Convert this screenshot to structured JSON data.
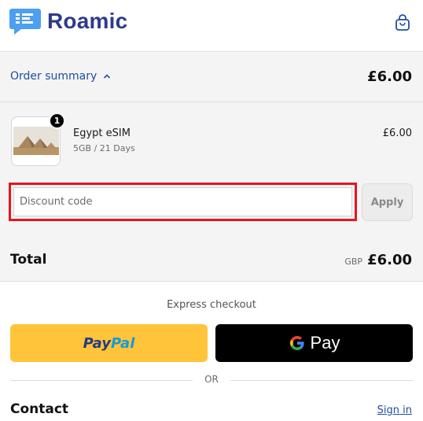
{
  "header": {
    "brand": "Roamic",
    "logo_icon": "sim-chat-logo-icon",
    "cart_icon": "shopping-bag-icon",
    "brand_color": "#2e3a8c"
  },
  "summary": {
    "toggle_label": "Order summary",
    "toggle_icon": "chevron-up-icon",
    "total": "£6.00"
  },
  "item": {
    "quantity": "1",
    "name": "Egypt eSIM",
    "variant": "5GB / 21 Days",
    "price": "£6.00"
  },
  "discount": {
    "placeholder": "Discount code",
    "apply_label": "Apply",
    "highlight_color": "#e8141c"
  },
  "totals": {
    "label": "Total",
    "currency": "GBP",
    "amount": "£6.00"
  },
  "express": {
    "label": "Express checkout",
    "paypal_part1": "Pay",
    "paypal_part2": "Pal",
    "gpay_label": "Pay",
    "or_label": "OR"
  },
  "contact": {
    "title": "Contact",
    "signin": "Sign in"
  }
}
